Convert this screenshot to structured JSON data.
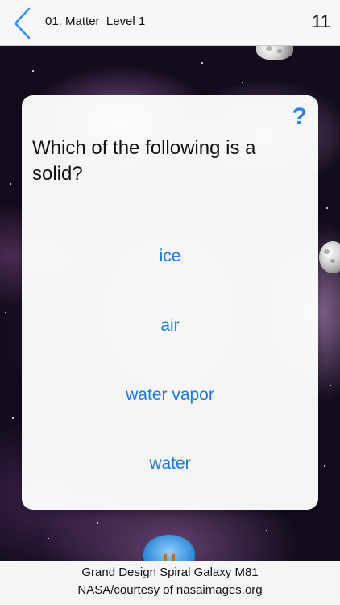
{
  "nav": {
    "title": "01. Matter  Level 1",
    "score": "11"
  },
  "card": {
    "help_label": "?",
    "question": "Which of the following is a solid?",
    "answers": [
      "ice",
      "air",
      "water vapor",
      "water"
    ]
  },
  "credit": {
    "line1": "Grand Design Spiral Galaxy M81",
    "line2": "NASA/courtesy of nasaimages.org"
  },
  "colors": {
    "accent": "#2a86e0",
    "answer_text": "#1a7bd4"
  }
}
